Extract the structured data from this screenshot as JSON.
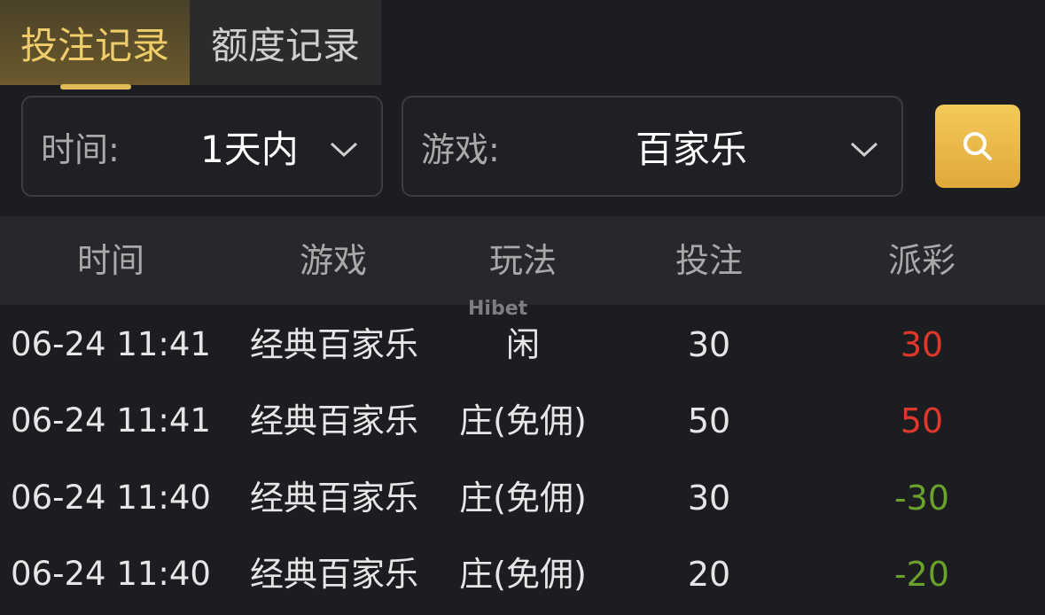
{
  "tabs": [
    {
      "label": "投注记录",
      "active": true
    },
    {
      "label": "额度记录",
      "active": false
    }
  ],
  "filters": {
    "time": {
      "label": "时间:",
      "value": "1天内"
    },
    "game": {
      "label": "游戏:",
      "value": "百家乐"
    }
  },
  "search": {
    "icon": "search-icon"
  },
  "table": {
    "headers": [
      "时间",
      "游戏",
      "玩法",
      "投注",
      "派彩"
    ],
    "rows": [
      {
        "time": "06-24 11:41",
        "game": "经典百家乐",
        "play": "闲",
        "bet": "30",
        "payout": "30"
      },
      {
        "time": "06-24 11:41",
        "game": "经典百家乐",
        "play": "庄(免佣)",
        "bet": "50",
        "payout": "50"
      },
      {
        "time": "06-24 11:40",
        "game": "经典百家乐",
        "play": "庄(免佣)",
        "bet": "30",
        "payout": "-30"
      },
      {
        "time": "06-24 11:40",
        "game": "经典百家乐",
        "play": "庄(免佣)",
        "bet": "20",
        "payout": "-20"
      }
    ]
  },
  "watermark": "Hibet",
  "colors": {
    "accent": "#e3bb56",
    "positive": "#e0372c",
    "negative": "#6aa02c",
    "background": "#1c1d21"
  }
}
